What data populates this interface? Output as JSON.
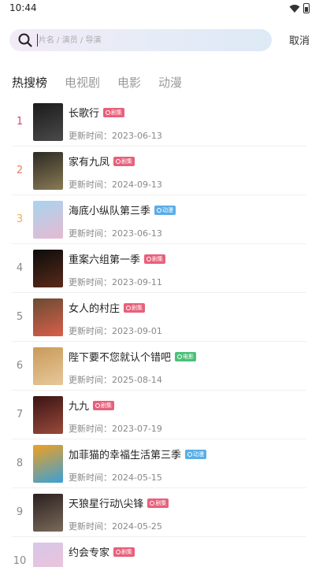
{
  "status": {
    "time": "10:44"
  },
  "search": {
    "placeholder": "片名 / 演员 / 导演",
    "cancel_label": "取消"
  },
  "tabs": [
    {
      "label": "热搜榜",
      "active": true
    },
    {
      "label": "电视剧",
      "active": false
    },
    {
      "label": "电影",
      "active": false
    },
    {
      "label": "动漫",
      "active": false
    }
  ],
  "list": [
    {
      "rank": "1",
      "title": "长歌行",
      "badge": "剧集",
      "badge_color": "#e8607a",
      "updated": "更新时间：2023-06-13",
      "poster_colors": [
        "#1b1b1b",
        "#4a4a4a"
      ]
    },
    {
      "rank": "2",
      "title": "家有九凤",
      "badge": "剧集",
      "badge_color": "#e8607a",
      "updated": "更新时间：2024-09-13",
      "poster_colors": [
        "#2b2a22",
        "#8a7a55"
      ]
    },
    {
      "rank": "3",
      "title": "海底小纵队第三季",
      "badge": "动漫",
      "badge_color": "#5aaee6",
      "updated": "更新时间：2023-06-13",
      "poster_colors": [
        "#a8d4ee",
        "#e6b9d2"
      ]
    },
    {
      "rank": "4",
      "title": "重案六组第一季",
      "badge": "剧集",
      "badge_color": "#e8607a",
      "updated": "更新时间：2023-09-11",
      "poster_colors": [
        "#0c0c0c",
        "#5a2a1a"
      ]
    },
    {
      "rank": "5",
      "title": "女人的村庄",
      "badge": "剧集",
      "badge_color": "#e8607a",
      "updated": "更新时间：2023-09-01",
      "poster_colors": [
        "#6a4b34",
        "#d95f4a"
      ]
    },
    {
      "rank": "6",
      "title": "陛下要不您就认个错吧",
      "badge": "电影",
      "badge_color": "#4cc07a",
      "updated": "更新时间：2025-08-14",
      "poster_colors": [
        "#c99a5a",
        "#e7c89a"
      ]
    },
    {
      "rank": "7",
      "title": "九九",
      "badge": "剧集",
      "badge_color": "#e8607a",
      "updated": "更新时间：2023-07-19",
      "poster_colors": [
        "#3a1414",
        "#9a4a3a"
      ]
    },
    {
      "rank": "8",
      "title": "加菲猫的幸福生活第三季",
      "badge": "动漫",
      "badge_color": "#5aaee6",
      "updated": "更新时间：2024-05-15",
      "poster_colors": [
        "#f0a020",
        "#3aa0d8"
      ]
    },
    {
      "rank": "9",
      "title": "天狼星行动\\尖锋",
      "badge": "剧集",
      "badge_color": "#e8607a",
      "updated": "更新时间：2024-05-25",
      "poster_colors": [
        "#2a2020",
        "#7a6a5a"
      ]
    },
    {
      "rank": "10",
      "title": "约会专家",
      "badge": "剧集",
      "badge_color": "#e8607a",
      "updated": "",
      "poster_colors": [
        "#d7c6e8",
        "#f2c3d6"
      ]
    }
  ],
  "icons": {
    "search": "search-icon",
    "wifi": "wifi-icon",
    "battery": "battery-icon"
  }
}
